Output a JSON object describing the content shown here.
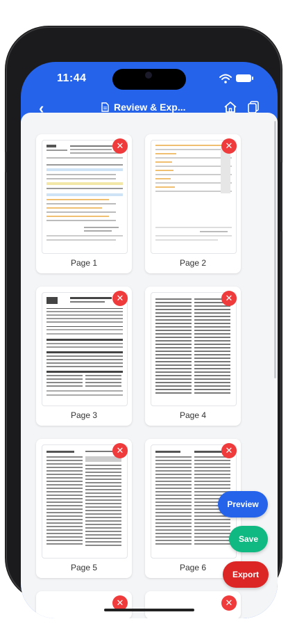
{
  "status": {
    "time": "11:44"
  },
  "header": {
    "title": "Review & Exp..."
  },
  "pages": [
    {
      "label": "Page 1"
    },
    {
      "label": "Page 2"
    },
    {
      "label": "Page 3"
    },
    {
      "label": "Page 4"
    },
    {
      "label": "Page 5"
    },
    {
      "label": "Page 6"
    }
  ],
  "actions": {
    "preview_label": "Preview",
    "save_label": "Save",
    "export_label": "Export"
  },
  "colors": {
    "header_bg": "#2563eb",
    "delete": "#ef3b3b",
    "preview": "#2563eb",
    "save": "#10b981",
    "export": "#dc2626"
  }
}
